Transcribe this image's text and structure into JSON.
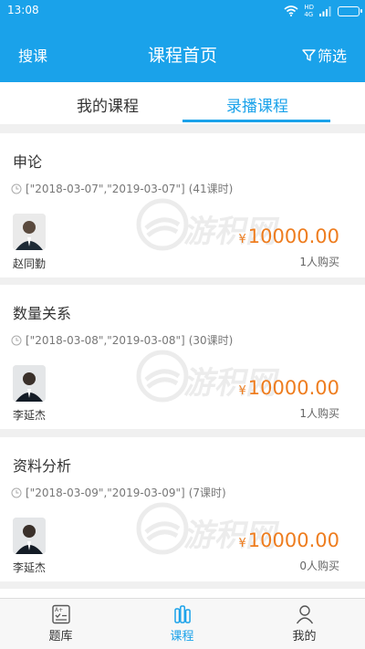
{
  "status_bar": {
    "time": "13:08",
    "network": "HD",
    "signal": "4G"
  },
  "header": {
    "left_label": "搜课",
    "title": "课程首页",
    "right_label": "筛选"
  },
  "tabs": [
    {
      "label": "我的课程",
      "active": false
    },
    {
      "label": "录播课程",
      "active": true
    }
  ],
  "courses": [
    {
      "title": "申论",
      "date_range": "[\"2018-03-07\",\"2019-03-07\"]",
      "hours": "(41课时)",
      "teacher": "赵同勤",
      "currency": "¥",
      "price": "10000.00",
      "buyers": "1人购买"
    },
    {
      "title": "数量关系",
      "date_range": "[\"2018-03-08\",\"2019-03-08\"]",
      "hours": "(30课时)",
      "teacher": "李延杰",
      "currency": "¥",
      "price": "10000.00",
      "buyers": "1人购买"
    },
    {
      "title": "资料分析",
      "date_range": "[\"2018-03-09\",\"2019-03-09\"]",
      "hours": "(7课时)",
      "teacher": "李延杰",
      "currency": "¥",
      "price": "10000.00",
      "buyers": "0人购买"
    }
  ],
  "watermark": "游积网",
  "bottom_nav": [
    {
      "label": "题库",
      "icon": "question-bank-icon",
      "active": false
    },
    {
      "label": "课程",
      "icon": "course-icon",
      "active": true
    },
    {
      "label": "我的",
      "icon": "profile-icon",
      "active": false
    }
  ],
  "colors": {
    "primary": "#1aa2ea",
    "price": "#ee7d1f"
  }
}
